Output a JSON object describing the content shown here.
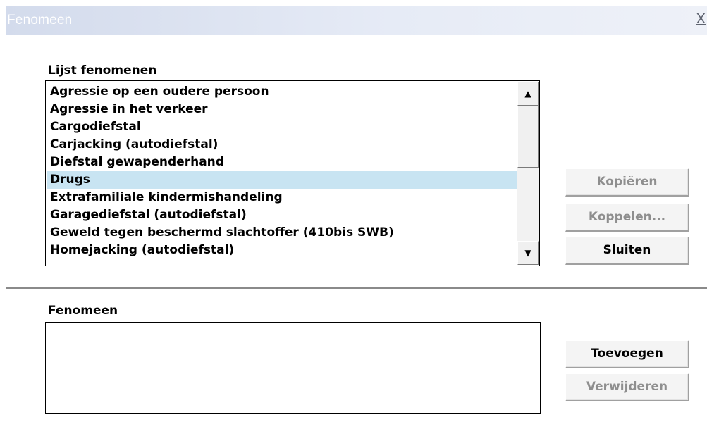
{
  "window": {
    "title": "Fenomeen",
    "close_label": "X"
  },
  "list_section": {
    "label": "Lijst fenomenen",
    "selected_index": 5,
    "items": [
      "Agressie  op een oudere persoon",
      "Agressie in het verkeer",
      "Cargodiefstal",
      "Carjacking (autodiefstal)",
      "Diefstal gewapenderhand",
      "Drugs",
      "Extrafamiliale kindermishandeling",
      "Garagediefstal (autodiefstal)",
      "Geweld tegen beschermd slachtoffer (410bis SWB)",
      "Homejacking (autodiefstal)"
    ],
    "scroll_up_glyph": "▲",
    "scroll_down_glyph": "▼"
  },
  "buttons_top": {
    "copy": {
      "label": "Kopiëren",
      "enabled": false
    },
    "link": {
      "label": "Koppelen...",
      "enabled": false
    },
    "close": {
      "label": "Sluiten",
      "enabled": true
    }
  },
  "fenomeen_section": {
    "label": "Fenomeen",
    "value": ""
  },
  "buttons_bottom": {
    "add": {
      "label": "Toevoegen",
      "enabled": true
    },
    "remove": {
      "label": "Verwijderen",
      "enabled": false
    }
  },
  "colors": {
    "selection": "#c8e4f2",
    "disabled_text": "#8e8e8e",
    "title_text": "#ffffff"
  }
}
